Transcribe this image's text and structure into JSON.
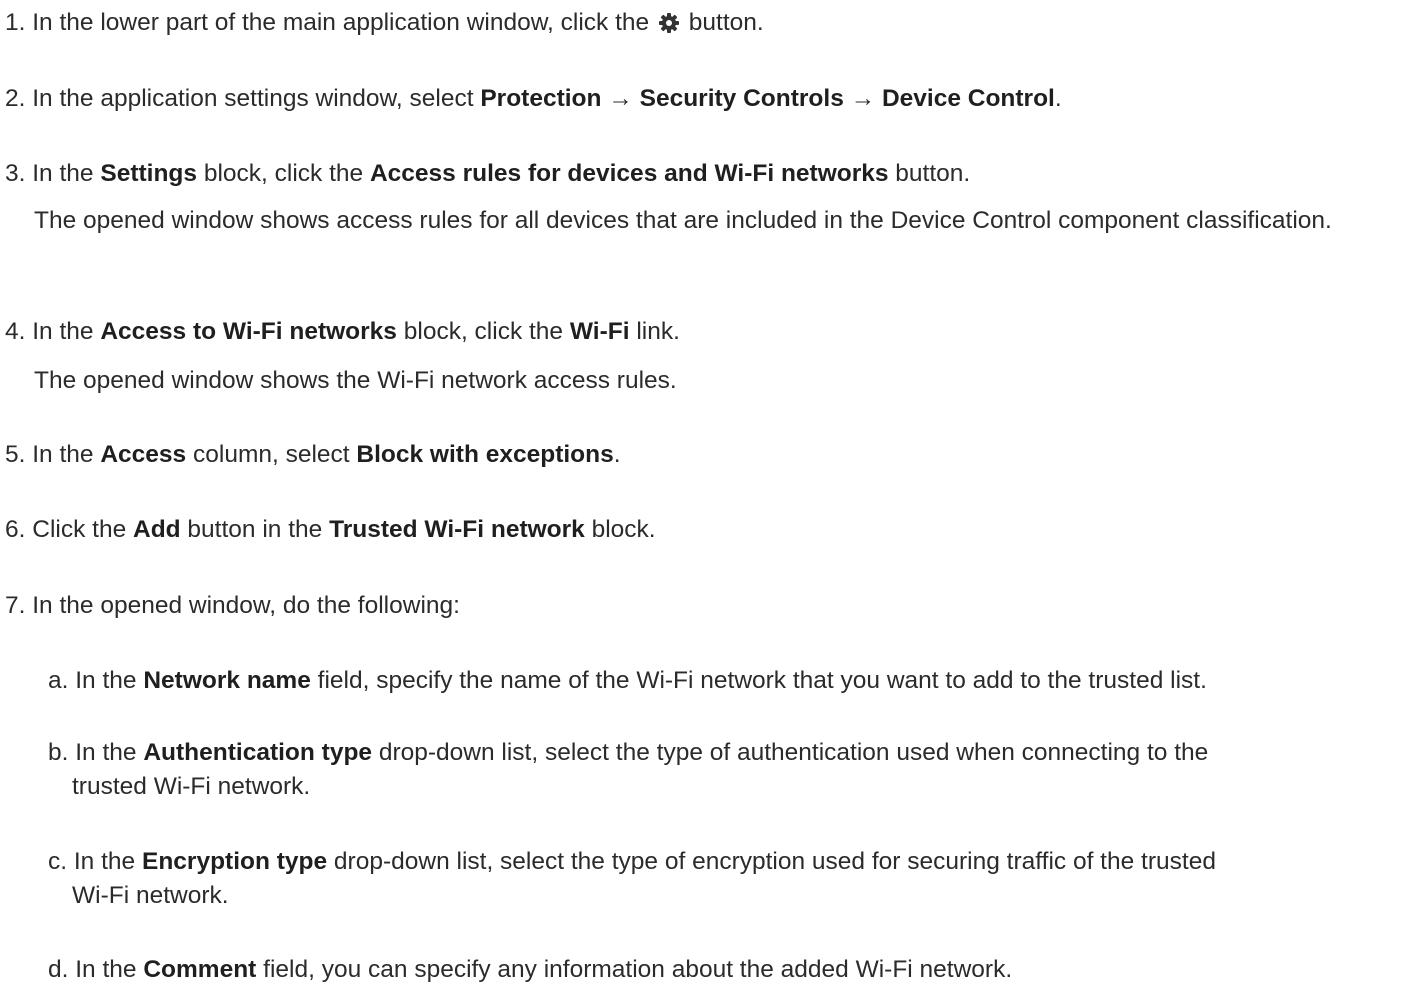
{
  "steps": {
    "s1": {
      "num": "1.",
      "a": " In the lower part of the main application window, click the ",
      "icon": "gear-icon",
      "b": " button."
    },
    "s2": {
      "num": "2.",
      "a": " In the application settings window, select ",
      "b1": "Protection",
      "arr1": " → ",
      "b2": "Security Controls",
      "arr2": " → ",
      "b3": "Device Control",
      "end": "."
    },
    "s3": {
      "num": "3.",
      "a": " In the ",
      "b1": "Settings",
      "m": " block, click the ",
      "b2": "Access rules for devices and Wi-Fi networks",
      "end": " button.",
      "note": "The opened window shows access rules for all devices that are included in the Device Control component classification."
    },
    "s4": {
      "num": "4.",
      "a": " In the ",
      "b1": "Access to Wi-Fi networks",
      "m": " block, click the ",
      "b2": "Wi-Fi",
      "end": " link.",
      "note": "The opened window shows the Wi-Fi network access rules."
    },
    "s5": {
      "num": "5.",
      "a": " In the ",
      "b1": "Access",
      "m": " column, select ",
      "b2": "Block with exceptions",
      "end": "."
    },
    "s6": {
      "num": "6.",
      "a": " Click the ",
      "b1": "Add",
      "m": " button in the ",
      "b2": "Trusted Wi-Fi network",
      "end": " block."
    },
    "s7": {
      "num": "7.",
      "a": " In the opened window, do the following:"
    }
  },
  "substeps": {
    "a": {
      "letter": "a.",
      "pre": " In the ",
      "bold": "Network name",
      "post": " field, specify the name of the Wi-Fi network that you want to add to the trusted list."
    },
    "b": {
      "letter": "b.",
      "pre": " In the ",
      "bold": "Authentication type",
      "post": " drop-down list, select the type of authentication used when connecting to the",
      "cont": "trusted Wi-Fi network."
    },
    "c": {
      "letter": "c.",
      "pre": " In the ",
      "bold": "Encryption type",
      "post": " drop-down list, select the type of encryption used for securing traffic of the trusted",
      "cont": "Wi-Fi network."
    },
    "d": {
      "letter": "d.",
      "pre": " In the ",
      "bold": "Comment",
      "post": " field, you can specify any information about the added Wi-Fi network."
    }
  },
  "colors": {
    "text": "#2b2b2b",
    "background": "#ffffff"
  }
}
